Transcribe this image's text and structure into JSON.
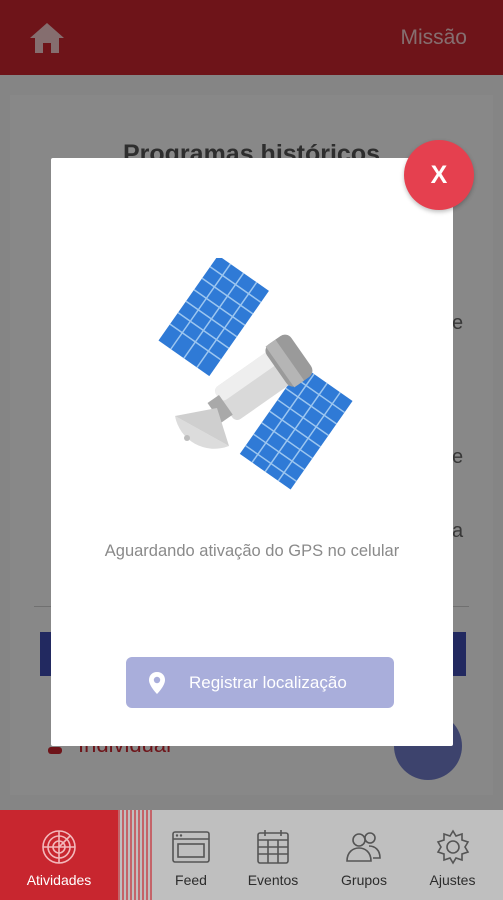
{
  "header": {
    "title": "Missão"
  },
  "background": {
    "title": "Programas históricos",
    "item_label": "Individual",
    "side_letters": [
      "e",
      "e",
      "a"
    ]
  },
  "modal": {
    "message": "Aguardando ativação do GPS no celular",
    "button_label": "Registrar localização",
    "close_label": "X"
  },
  "nav": {
    "items": [
      {
        "label": "Atividades",
        "icon": "radar-icon",
        "active": true
      },
      {
        "label": "Feed",
        "icon": "browser-icon",
        "active": false
      },
      {
        "label": "Eventos",
        "icon": "calendar-icon",
        "active": false
      },
      {
        "label": "Grupos",
        "icon": "group-icon",
        "active": false
      },
      {
        "label": "Ajustes",
        "icon": "gear-icon",
        "active": false
      }
    ]
  },
  "colors": {
    "brand_red": "#c8262f",
    "close_red": "#e5404f",
    "button_lavender": "#a9aedb",
    "accent_blue": "#3f4bb0"
  }
}
